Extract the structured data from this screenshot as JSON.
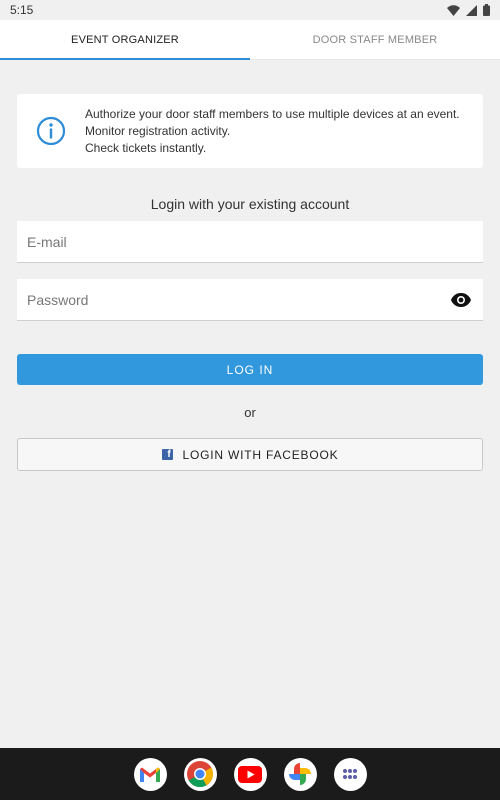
{
  "status_bar": {
    "time": "5:15",
    "icons": [
      "wifi-icon",
      "signal-icon",
      "battery-icon"
    ]
  },
  "tabs": [
    {
      "label": "EVENT ORGANIZER",
      "active": true
    },
    {
      "label": "DOOR STAFF MEMBER",
      "active": false
    }
  ],
  "info": {
    "icon": "info-icon",
    "lines": [
      "Authorize your door staff members to use multiple devices at an event.",
      "Monitor registration activity.",
      "Check tickets instantly."
    ]
  },
  "login": {
    "heading": "Login with your existing account",
    "email_placeholder": "E-mail",
    "password_placeholder": "Password",
    "password_toggle_icon": "eye-icon",
    "login_button": "LOG IN",
    "or_text": "or",
    "facebook_button": "LOGIN WITH FACEBOOK"
  },
  "dock": {
    "apps": [
      "gmail-icon",
      "chrome-icon",
      "youtube-icon",
      "photos-icon",
      "app-drawer-icon"
    ]
  },
  "colors": {
    "accent": "#3198dd",
    "background": "#f0f0f0",
    "facebook": "#3a63a8"
  }
}
